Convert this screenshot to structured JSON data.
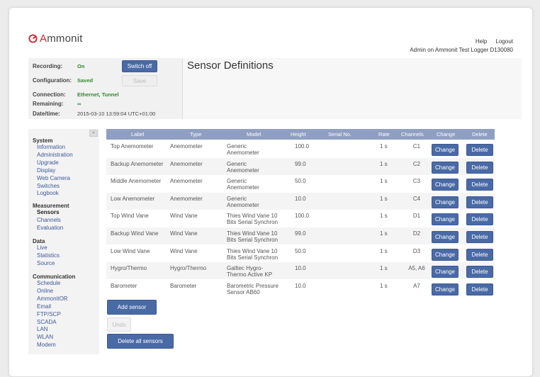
{
  "header": {
    "logo_text_prefix": "A",
    "logo_text_rest": "mmonit",
    "help_link": "Help",
    "logout_link": "Logout",
    "admin_info": "Admin on Ammonit Test Logger D130080"
  },
  "status": {
    "recording_label": "Recording:",
    "recording_value": "On",
    "switch_off_button": "Switch off",
    "configuration_label": "Configuration:",
    "configuration_value": "Saved",
    "save_button": "Save",
    "connection_label": "Connection:",
    "connection_value": "Ethernet, Tunnel",
    "remaining_label": "Remaining:",
    "remaining_value": "∞",
    "datetime_label": "Date/time:",
    "datetime_value": "2015-03-10 13:59:04 UTC+01:00"
  },
  "page_title": "Sensor Definitions",
  "sidebar": {
    "collapse_icon": "«",
    "sections": [
      {
        "heading": "System",
        "items": [
          "Information",
          "Administration",
          "Upgrade",
          "Display",
          "Web Camera",
          "Switches",
          "Logbook"
        ]
      },
      {
        "heading": "Measurement",
        "items": [
          "Sensors",
          "Channels",
          "Evaluation"
        ]
      },
      {
        "heading": "Data",
        "items": [
          "Live",
          "Statistics",
          "Source"
        ]
      },
      {
        "heading": "Communication",
        "items": [
          "Schedule",
          "Online",
          "AmmonitOR",
          "Email",
          "FTP/SCP",
          "SCADA",
          "LAN",
          "WLAN",
          "Modem"
        ]
      }
    ],
    "active_item": "Sensors"
  },
  "table": {
    "columns": [
      "Label",
      "Type",
      "Model",
      "Height",
      "Serial No.",
      "Rate",
      "Channels",
      "Change",
      "Delete"
    ],
    "change_label": "Change",
    "delete_label": "Delete",
    "rows": [
      {
        "label": "Top Anemometer",
        "type": "Anemometer",
        "model": [
          "Generic",
          "Anemometer"
        ],
        "height": "100.0",
        "serial": "",
        "rate": "1 s",
        "channels": "C1"
      },
      {
        "label": "Backup Anemometer",
        "type": "Anemometer",
        "model": [
          "Generic",
          "Anemometer"
        ],
        "height": "99.0",
        "serial": "",
        "rate": "1 s",
        "channels": "C2"
      },
      {
        "label": "Middle Anemometer",
        "type": "Anemometer",
        "model": [
          "Generic",
          "Anemometer"
        ],
        "height": "50.0",
        "serial": "",
        "rate": "1 s",
        "channels": "C3"
      },
      {
        "label": "Low Anemometer",
        "type": "Anemometer",
        "model": [
          "Generic",
          "Anemometer"
        ],
        "height": "10.0",
        "serial": "",
        "rate": "1 s",
        "channels": "C4"
      },
      {
        "label": "Top Wind Vane",
        "type": "Wind Vane",
        "model": [
          "Thies Wind Vane 10",
          "Bits Serial Synchron"
        ],
        "height": "100.0",
        "serial": "",
        "rate": "1 s",
        "channels": "D1"
      },
      {
        "label": "Backup Wind Vane",
        "type": "Wind Vane",
        "model": [
          "Thies Wind Vane 10",
          "Bits Serial Synchron"
        ],
        "height": "99.0",
        "serial": "",
        "rate": "1 s",
        "channels": "D2"
      },
      {
        "label": "Low Wind Vane",
        "type": "Wind Vane",
        "model": [
          "Thies Wind Vane 10",
          "Bits Serial Synchron"
        ],
        "height": "50.0",
        "serial": "",
        "rate": "1 s",
        "channels": "D3"
      },
      {
        "label": "Hygro/Thermo",
        "type": "Hygro/Thermo",
        "model": [
          "Galltec Hygro-",
          "Thermo Active KP"
        ],
        "height": "10.0",
        "serial": "",
        "rate": "1 s",
        "channels": "A5, A6"
      },
      {
        "label": "Barometer",
        "type": "Barometer",
        "model": [
          "Barometric Pressure",
          "Sensor AB60"
        ],
        "height": "10.0",
        "serial": "",
        "rate": "1 s",
        "channels": "A7"
      }
    ]
  },
  "actions": {
    "add_sensor": "Add sensor",
    "undo": "Undo",
    "delete_all": "Delete all sensors"
  },
  "colors": {
    "accent": "#4a6aa6",
    "table_header": "#8f9fc2",
    "status_ok": "#2f8a2f",
    "logo_red": "#c8282c"
  }
}
